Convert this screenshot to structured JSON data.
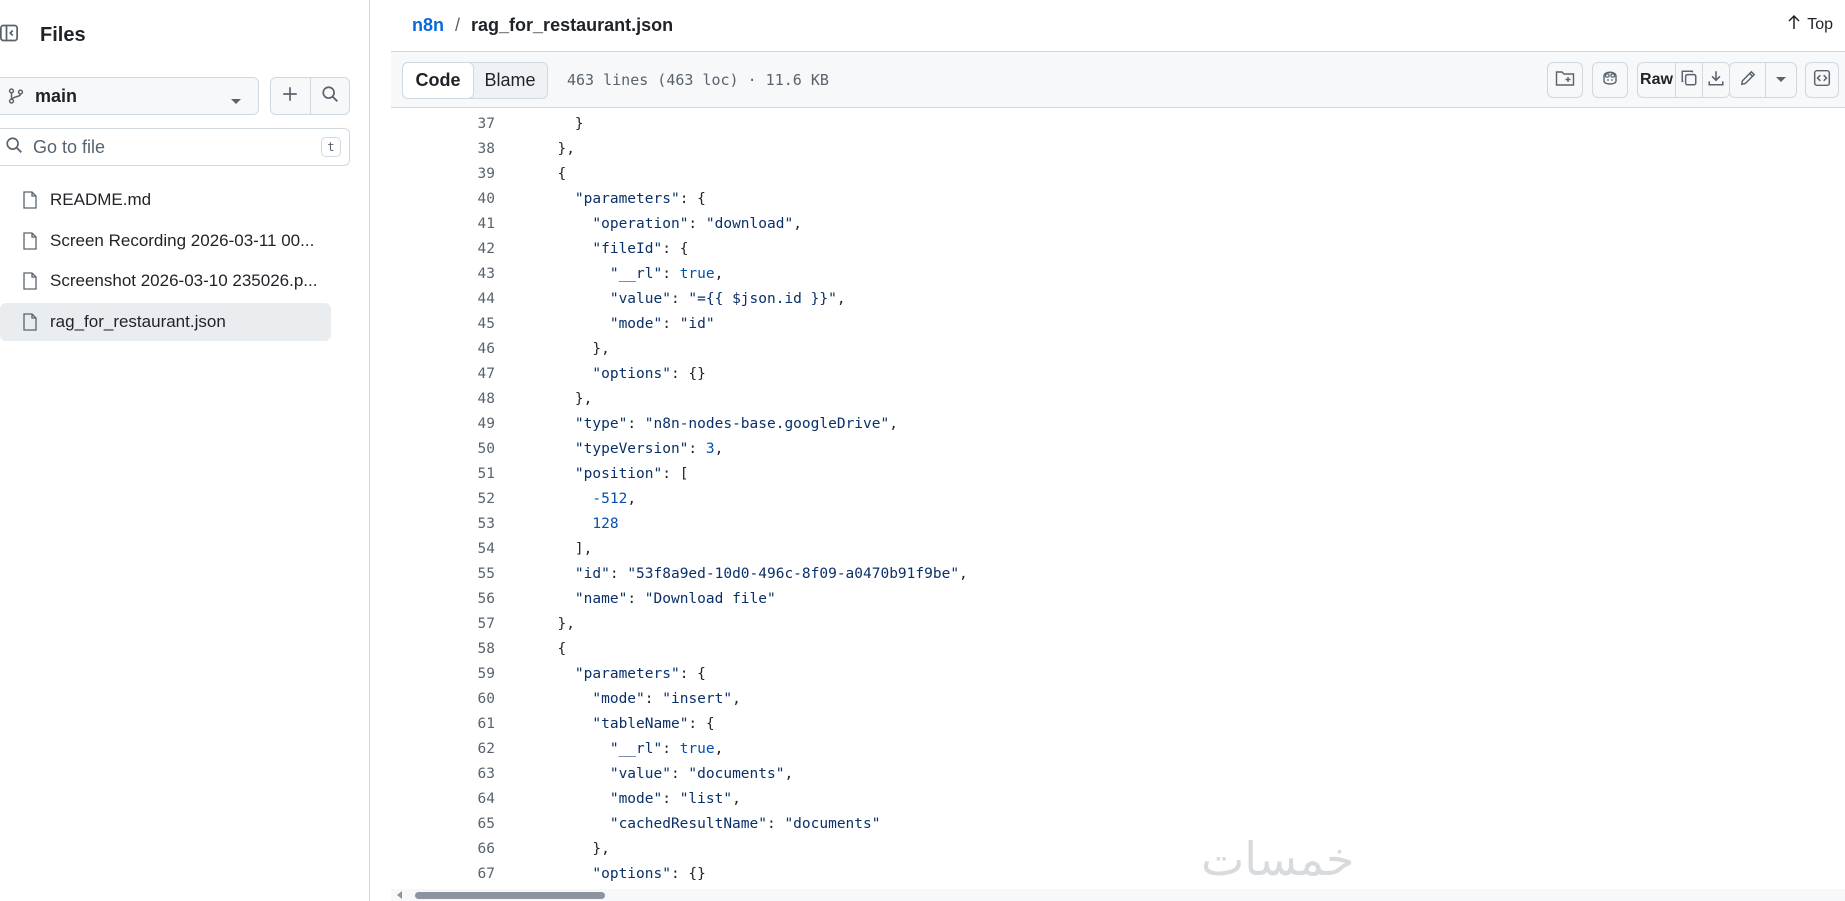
{
  "sidebar": {
    "title": "Files",
    "branch": "main",
    "goto_placeholder": "Go to file",
    "goto_shortcut": "t",
    "files": [
      {
        "label": "README.md",
        "active": false
      },
      {
        "label": "Screen Recording 2026-03-11 00...",
        "active": false
      },
      {
        "label": "Screenshot 2026-03-10 235026.p...",
        "active": false
      },
      {
        "label": "rag_for_restaurant.json",
        "active": true
      }
    ]
  },
  "header": {
    "repo": "n8n",
    "separator": "/",
    "filename": "rag_for_restaurant.json",
    "top_label": "Top"
  },
  "toolbar": {
    "code_tab": "Code",
    "blame_tab": "Blame",
    "file_meta": "463 lines (463 loc) · 11.6 KB",
    "raw_label": "Raw"
  },
  "code": {
    "lines": [
      {
        "n": "37",
        "text": "    }"
      },
      {
        "n": "38",
        "text": "  },"
      },
      {
        "n": "39",
        "text": "  {"
      },
      {
        "n": "40",
        "text": "    \"parameters\": {"
      },
      {
        "n": "41",
        "text": "      \"operation\": \"download\","
      },
      {
        "n": "42",
        "text": "      \"fileId\": {"
      },
      {
        "n": "43",
        "text": "        \"__rl\": true,"
      },
      {
        "n": "44",
        "text": "        \"value\": \"={{ $json.id }}\","
      },
      {
        "n": "45",
        "text": "        \"mode\": \"id\""
      },
      {
        "n": "46",
        "text": "      },"
      },
      {
        "n": "47",
        "text": "      \"options\": {}"
      },
      {
        "n": "48",
        "text": "    },"
      },
      {
        "n": "49",
        "text": "    \"type\": \"n8n-nodes-base.googleDrive\","
      },
      {
        "n": "50",
        "text": "    \"typeVersion\": 3,"
      },
      {
        "n": "51",
        "text": "    \"position\": ["
      },
      {
        "n": "52",
        "text": "      -512,"
      },
      {
        "n": "53",
        "text": "      128"
      },
      {
        "n": "54",
        "text": "    ],"
      },
      {
        "n": "55",
        "text": "    \"id\": \"53f8a9ed-10d0-496c-8f09-a0470b91f9be\","
      },
      {
        "n": "56",
        "text": "    \"name\": \"Download file\""
      },
      {
        "n": "57",
        "text": "  },"
      },
      {
        "n": "58",
        "text": "  {"
      },
      {
        "n": "59",
        "text": "    \"parameters\": {"
      },
      {
        "n": "60",
        "text": "      \"mode\": \"insert\","
      },
      {
        "n": "61",
        "text": "      \"tableName\": {"
      },
      {
        "n": "62",
        "text": "        \"__rl\": true,"
      },
      {
        "n": "63",
        "text": "        \"value\": \"documents\","
      },
      {
        "n": "64",
        "text": "        \"mode\": \"list\","
      },
      {
        "n": "65",
        "text": "        \"cachedResultName\": \"documents\""
      },
      {
        "n": "66",
        "text": "      },"
      },
      {
        "n": "67",
        "text": "      \"options\": {}"
      }
    ]
  },
  "watermark": "خمسات",
  "colors": {
    "link": "#0969da",
    "json_key": "#0a3069",
    "json_number": "#0550ae",
    "active_file_bg": "#eaedf0"
  }
}
